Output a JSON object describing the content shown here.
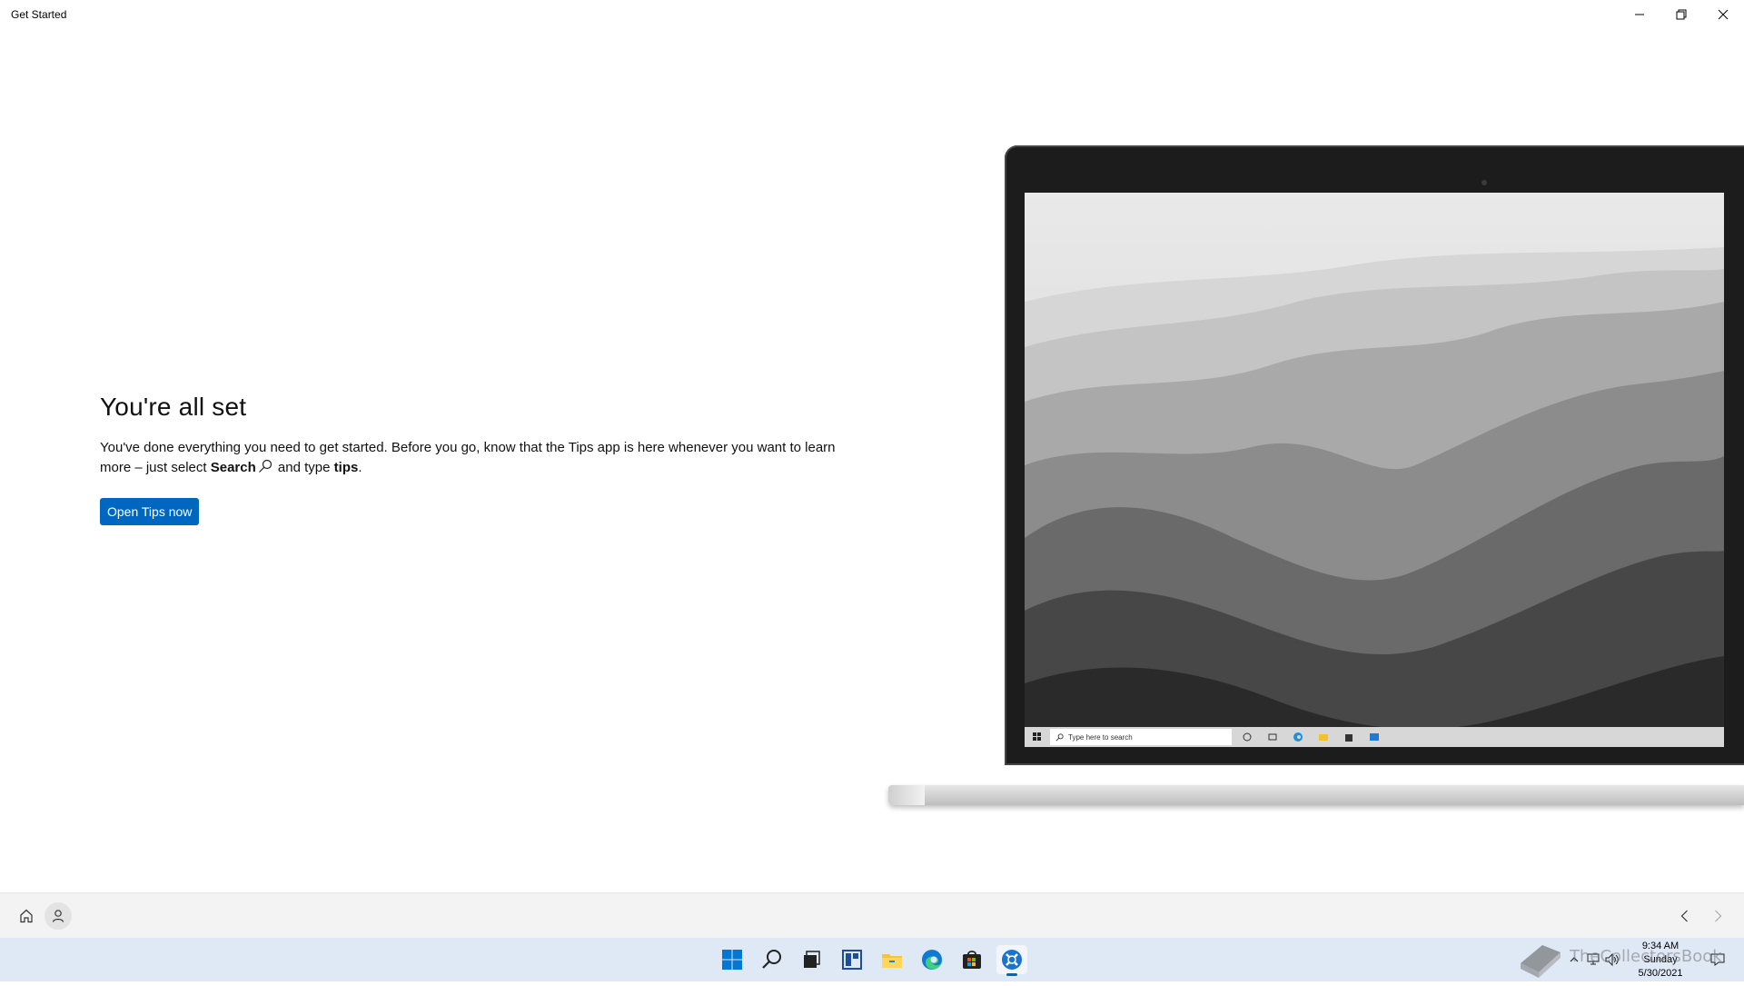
{
  "window": {
    "title": "Get Started",
    "controls": {
      "minimize": "minimize",
      "maximize": "restore",
      "close": "close"
    }
  },
  "main": {
    "heading": "You're all set",
    "body_part1": "You've done everything you need to get started. Before you go, know that the Tips app is here whenever you want to learn more – just select ",
    "search_word": "Search",
    "body_part2": " and type ",
    "tips_word": "tips",
    "body_end": ".",
    "button_label": "Open Tips now"
  },
  "illustration": {
    "taskbar_search_placeholder": "Type here to search"
  },
  "app_nav": {
    "icons": [
      "home-icon",
      "profile-icon",
      "back-icon",
      "forward-icon"
    ]
  },
  "taskbar": {
    "icons": [
      "windows-start-icon",
      "search-icon",
      "task-view-icon",
      "widgets-icon",
      "file-explorer-icon",
      "edge-icon",
      "store-icon",
      "get-started-icon"
    ],
    "active": "get-started-icon",
    "clock": {
      "time": "9:34 AM",
      "day": "Sunday",
      "date": "5/30/2021"
    }
  },
  "watermark": {
    "text": "TheCollectorsBook"
  },
  "colors": {
    "accent": "#0067c0",
    "taskbar": "#dfe8f5",
    "navbar": "#f3f3f3"
  }
}
